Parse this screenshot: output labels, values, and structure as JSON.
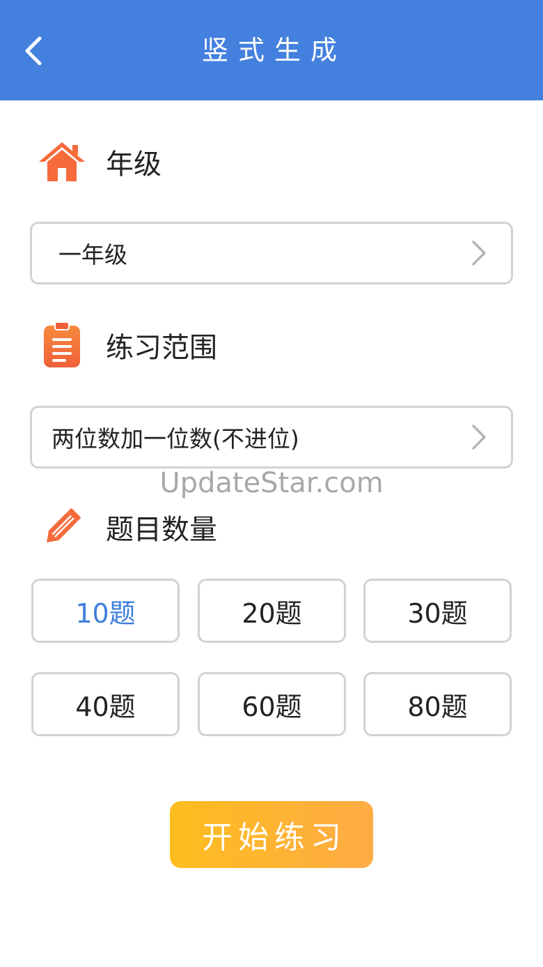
{
  "header": {
    "title": "竖式生成",
    "background_color": "#4480de",
    "back_icon": "chevron-left-icon"
  },
  "grade": {
    "label": "年级",
    "icon": "house-icon",
    "selected": "一年级"
  },
  "range": {
    "label": "练习范围",
    "icon": "clipboard-icon",
    "selected": "两位数加一位数(不进位)"
  },
  "quantity": {
    "label": "题目数量",
    "icon": "pencil-icon",
    "options": [
      "10题",
      "20题",
      "30题",
      "40题",
      "60题",
      "80题"
    ],
    "selected": "10题",
    "selected_color": "#3f7edb"
  },
  "watermark": "UpdateStar.com",
  "start_button": {
    "label": "开始练习"
  },
  "colors": {
    "accent_orange": "#f56b3b",
    "button_gradient_start": "#fdbd1e",
    "button_gradient_end": "#ffab45"
  }
}
